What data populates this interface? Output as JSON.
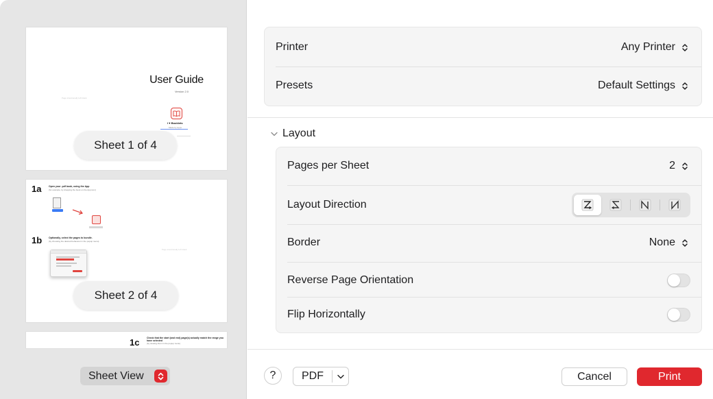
{
  "colors": {
    "accent": "#e0282e",
    "panel_bg": "#e6e6e6",
    "group_bg": "#f5f5f5"
  },
  "preview": {
    "sheets": [
      {
        "pill": "Sheet 1 of 4",
        "title": "User Guide",
        "version": "Version 2.0",
        "faint": "Page intentionally left blank",
        "brand": "I ♥ Booklets",
        "small": "Made by Apps"
      },
      {
        "pill": "Sheet 2 of 4",
        "steps": [
          {
            "num": "1a",
            "head": "Open your .pdf book, using the App",
            "sub": "(for example, by dropping the book on the App icon)"
          },
          {
            "num": "1b",
            "head": "Optionally, select the pages to bundle.",
            "sub": "(by choosing the desired behaviour in the popup menu)"
          }
        ],
        "faint": "Page intentionally left blank"
      },
      {
        "steps": [
          {
            "num": "1c",
            "head": "Check that the start (and end) page(s) actually match the range you have selected",
            "sub": "(by viewing them in the popup menu)"
          }
        ]
      }
    ],
    "view_mode": "Sheet View"
  },
  "settings": {
    "printer": {
      "label": "Printer",
      "value": "Any Printer"
    },
    "presets": {
      "label": "Presets",
      "value": "Default Settings"
    },
    "layout_header": "Layout",
    "pages_per_sheet": {
      "label": "Pages per Sheet",
      "value": "2"
    },
    "layout_direction": {
      "label": "Layout Direction",
      "options": [
        "z-left-to-right",
        "z-right-to-left",
        "n-left-to-right",
        "n-right-to-left"
      ],
      "selected": 0
    },
    "border": {
      "label": "Border",
      "value": "None"
    },
    "reverse_orientation": {
      "label": "Reverse Page Orientation",
      "on": false
    },
    "flip_horizontally": {
      "label": "Flip Horizontally",
      "on": false
    }
  },
  "footer": {
    "help": "?",
    "pdf": "PDF",
    "cancel": "Cancel",
    "print": "Print"
  }
}
